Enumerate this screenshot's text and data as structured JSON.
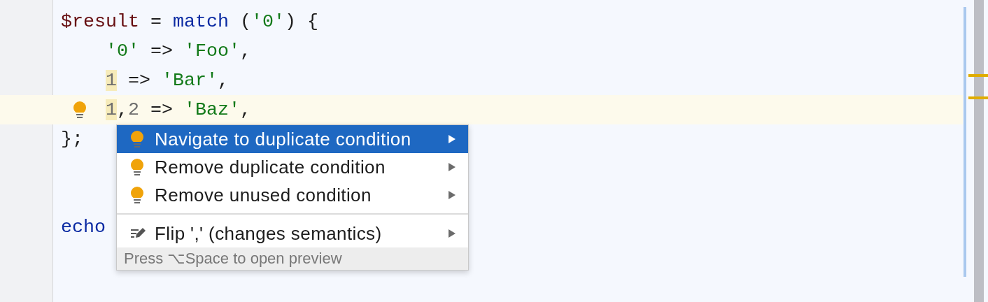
{
  "editor": {
    "lines": [
      {
        "current": false,
        "bulb": false,
        "tokens": [
          {
            "text": "$result",
            "kind": "var"
          },
          {
            "text": " = ",
            "kind": "plain"
          },
          {
            "text": "match",
            "kind": "kw"
          },
          {
            "text": " (",
            "kind": "plain"
          },
          {
            "text": "'0'",
            "kind": "str"
          },
          {
            "text": ") {",
            "kind": "plain"
          }
        ],
        "children": [
          {
            "current": false,
            "bulb": false,
            "tokens": [
              {
                "text": "'0'",
                "kind": "str"
              },
              {
                "text": " => ",
                "kind": "plain"
              },
              {
                "text": "'Foo'",
                "kind": "str"
              },
              {
                "text": ",",
                "kind": "plain"
              }
            ]
          },
          {
            "current": false,
            "bulb": false,
            "tokens": [
              {
                "text": "1",
                "kind": "num",
                "highlighted": true
              },
              {
                "text": " => ",
                "kind": "plain"
              },
              {
                "text": "'Bar'",
                "kind": "str"
              },
              {
                "text": ",",
                "kind": "plain"
              }
            ]
          },
          {
            "current": true,
            "bulb": true,
            "tokens": [
              {
                "text": "1",
                "kind": "num",
                "highlighted": true
              },
              {
                "text": ",",
                "kind": "plain"
              },
              {
                "text": "2",
                "kind": "num",
                "highlighted": false
              },
              {
                "text": " => ",
                "kind": "plain"
              },
              {
                "text": "'Baz'",
                "kind": "str"
              },
              {
                "text": ",",
                "kind": "plain"
              }
            ]
          }
        ]
      },
      {
        "current": false,
        "bulb": false,
        "tokens": [
          {
            "text": "};",
            "kind": "plain"
          }
        ]
      },
      {
        "current": false,
        "bulb": false
      },
      {
        "current": false,
        "bulb": false
      },
      {
        "current": false,
        "bulb": false,
        "tokens": [
          {
            "text": "echo",
            "kind": "kw"
          }
        ]
      }
    ]
  },
  "popup": {
    "items": [
      {
        "label": "Navigate to duplicate condition",
        "kind": "bulb",
        "selected": true,
        "divider_before": false
      },
      {
        "label": "Remove duplicate condition",
        "kind": "bulb",
        "selected": false,
        "divider_before": false
      },
      {
        "label": "Remove unused condition",
        "kind": "bulb",
        "selected": false,
        "divider_before": false
      },
      {
        "label": "Flip ',' (changes semantics)",
        "kind": "edit",
        "selected": false,
        "divider_before": true
      }
    ],
    "footer": "Press ⌥Space to open preview"
  }
}
